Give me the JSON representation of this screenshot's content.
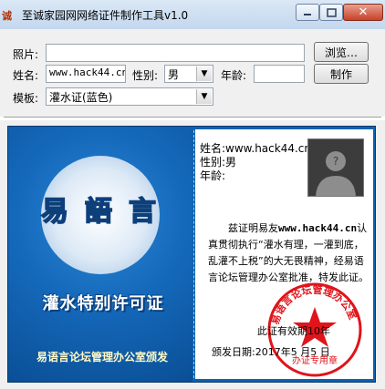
{
  "window": {
    "icon_text": "诚",
    "title": "至诚家园网网络证件制作工具v1.0",
    "minimize_icon": "minimize-icon",
    "maximize_icon": "maximize-icon",
    "close_icon": "close-icon"
  },
  "form": {
    "photo_label": "照片:",
    "photo_value": "",
    "browse_button": "浏览…",
    "name_label": "姓名:",
    "name_value": "www.hack44.cn",
    "gender_label": "性别:",
    "gender_value": "男",
    "age_label": "年龄:",
    "age_value": "",
    "make_button": "制作",
    "template_label": "模板:",
    "template_value": "灌水证(蓝色)"
  },
  "certificate": {
    "logo_chars": [
      "易",
      "語",
      "言"
    ],
    "title": "灌水特别许可证",
    "issuer": "易语言论坛管理办公室颁发",
    "name_line": "姓名:www.hack44.cn",
    "gender_line": "性别:男",
    "age_line": "年龄:",
    "body_prefix": "兹证明易友",
    "body_name": "www.hack44.cn",
    "body_suffix": "认真贯彻执行“灌水有理，一灌到底，乱灌不上税”的大无畏精神，经易语言论坛管理办公室批准，特发此证。",
    "validity": "此证有效期10年",
    "issue_date": "颁发日期:2017年5 月5 日",
    "stamp_ring_text": "易语言论坛管理办公室",
    "stamp_center_text": "办证专用章",
    "colors": {
      "card_blue": "#0d62b0",
      "stamp_red": "#e0141b",
      "issuer_yellow": "#fff9c7"
    }
  }
}
